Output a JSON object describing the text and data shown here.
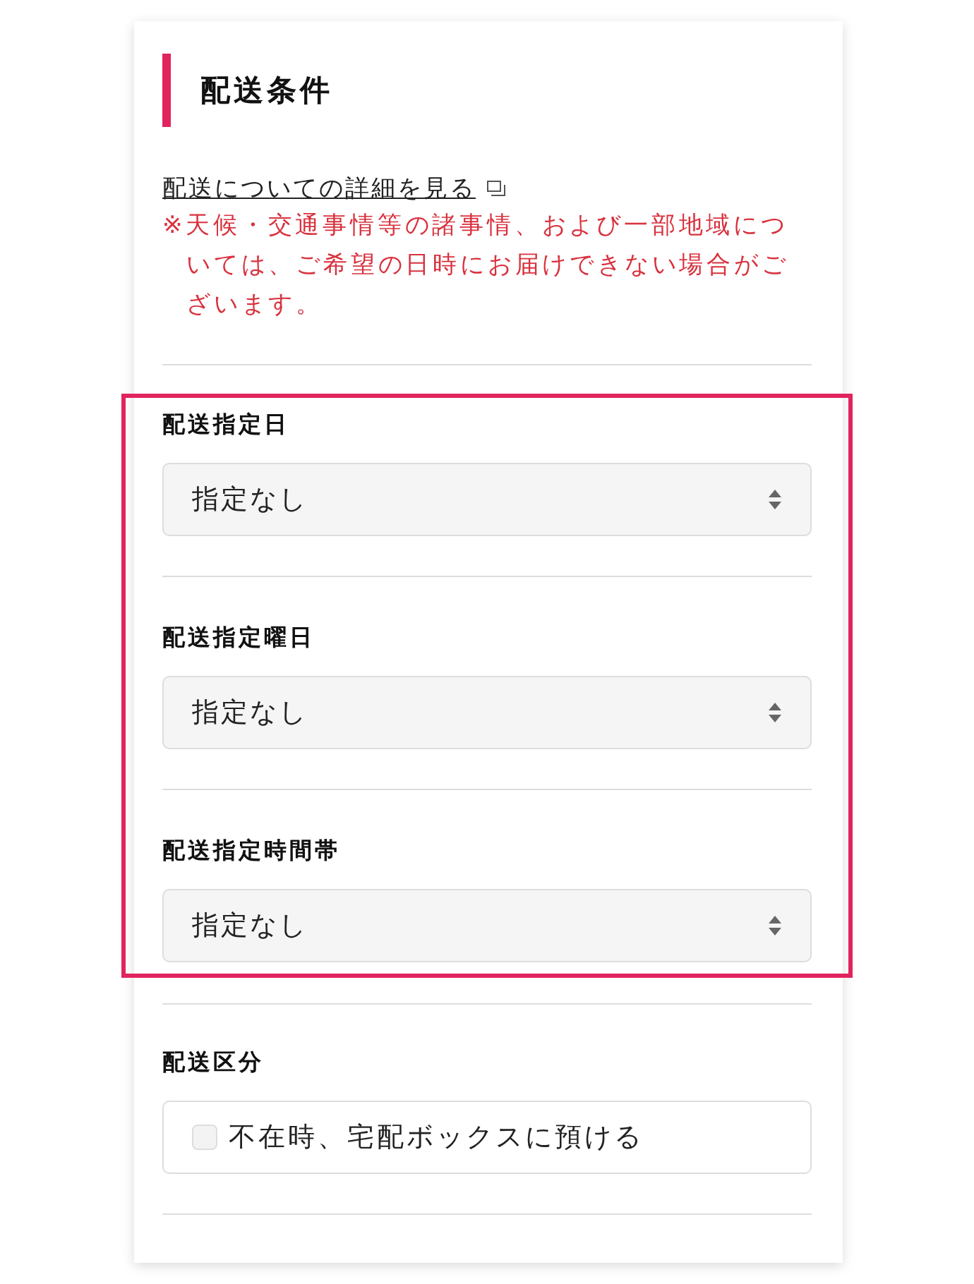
{
  "heading": "配送条件",
  "details_link": {
    "label": "配送についての詳細を見る"
  },
  "notice": "※天候・交通事情等の諸事情、および一部地域については、ご希望の日時にお届けできない場合がございます。",
  "fields": [
    {
      "kind": "select",
      "label": "配送指定日",
      "value": "指定なし",
      "highlighted": true
    },
    {
      "kind": "select",
      "label": "配送指定曜日",
      "value": "指定なし",
      "highlighted": true
    },
    {
      "kind": "select",
      "label": "配送指定時間帯",
      "value": "指定なし",
      "highlighted": true
    },
    {
      "kind": "checkbox",
      "label": "配送区分",
      "option": "不在時、宅配ボックスに預ける",
      "checked": false,
      "highlighted": false
    }
  ]
}
